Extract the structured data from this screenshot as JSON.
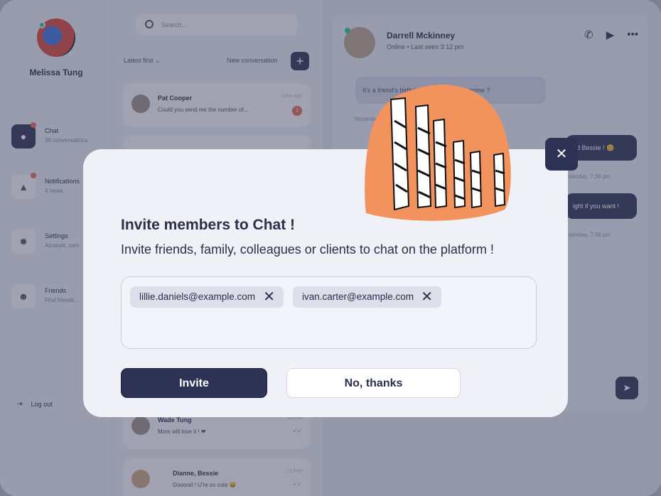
{
  "sidebar": {
    "user_name": "Melissa Tung",
    "nav": [
      {
        "title": "Chat",
        "sub": "36 conversations",
        "icon": "chat-bubble-icon"
      },
      {
        "title": "Notifications",
        "sub": "4 news",
        "icon": "bell-icon"
      },
      {
        "title": "Settings",
        "sub": "Account, com",
        "icon": "gear-icon"
      },
      {
        "title": "Friends",
        "sub": "Find friends...",
        "icon": "people-icon"
      }
    ],
    "logout": "Log out"
  },
  "conversations": {
    "search_placeholder": "Search...",
    "sort_label": "Latest first",
    "new_label": "New conversation",
    "items": [
      {
        "name": "Pat Cooper",
        "preview": "Could you send me the number of...",
        "time": "2min ago",
        "unread": "1"
      },
      {
        "name": "Wade Tung",
        "preview": "Mom will love it ! ❤",
        "time": "1d Feb",
        "unread": ""
      },
      {
        "name": "Dianne, Bessie",
        "preview": "Gooood ! U're so cute 😄",
        "time": "21 Feb",
        "unread": ""
      }
    ]
  },
  "chat": {
    "name": "Darrell Mckinney",
    "status": "Online  •  Last seen 3:12 pm",
    "message_in": "It's a friend's birthday, do you want to come ?",
    "meta_in": "Yesterday",
    "message_out_1": "nd Bessie ! 😊",
    "meta_out_1": "sterday, 7:36 pm",
    "message_out_2": "ight if you want !",
    "meta_out_2": "sterday, 7:36 pm"
  },
  "modal": {
    "title": "Invite members to Chat !",
    "subtitle": "Invite friends, family, colleagues or clients to chat on the platform !",
    "emails": [
      "lillie.daniels@example.com",
      "ivan.carter@example.com"
    ],
    "invite_label": "Invite",
    "decline_label": "No, thanks",
    "close_glyph": "✕",
    "accent_color": "#2e3356",
    "illustration_color": "#f2935e"
  }
}
